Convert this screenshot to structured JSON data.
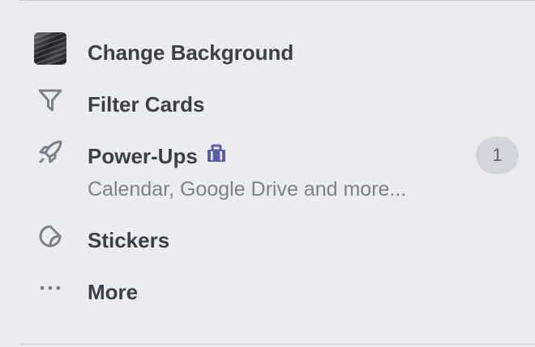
{
  "menu": {
    "items": [
      {
        "label": "Change Background",
        "icon": "background-thumbnail"
      },
      {
        "label": "Filter Cards",
        "icon": "filter-icon"
      },
      {
        "label": "Power-Ups",
        "icon": "rocket-icon",
        "sublabel": "Calendar, Google Drive and more...",
        "badge_icon": "briefcase-icon",
        "count": "1"
      },
      {
        "label": "Stickers",
        "icon": "sticker-icon"
      },
      {
        "label": "More",
        "icon": "more-icon"
      }
    ]
  },
  "colors": {
    "background": "#ebecf0",
    "text": "#3a3f48",
    "subtext": "#7b818a",
    "icon": "#7b818a",
    "badge_bg": "#d2d6dc",
    "briefcase": "#5b5ea6"
  }
}
